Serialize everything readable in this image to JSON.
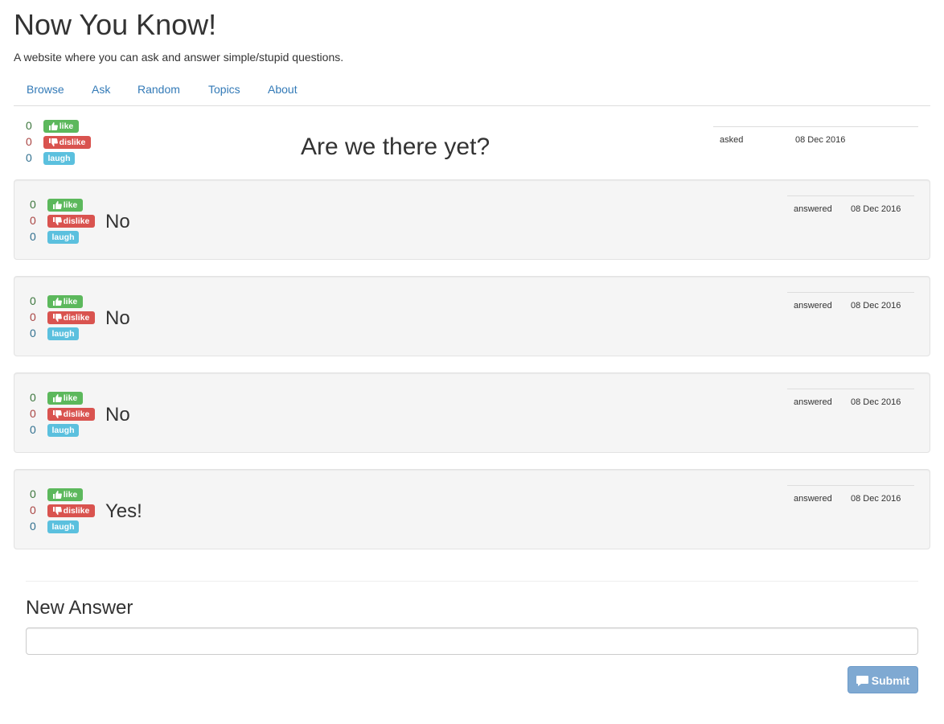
{
  "site": {
    "title": "Now You Know!",
    "subtitle": "A website where you can ask and answer simple/stupid questions."
  },
  "nav": [
    "Browse",
    "Ask",
    "Random",
    "Topics",
    "About"
  ],
  "labels": {
    "like": "like",
    "dislike": "dislike",
    "laugh": "laugh"
  },
  "colors": {
    "like": "#5cb85c",
    "dislike": "#d9534f",
    "laugh": "#5bc0de",
    "link": "#337ab7",
    "submit": "#7fa9d2"
  },
  "question": {
    "title": "Are we there yet?",
    "likes": "0",
    "dislikes": "0",
    "laughs": "0",
    "meta_label": "asked",
    "date": "08 Dec 2016"
  },
  "answers": [
    {
      "text": "No",
      "likes": "0",
      "dislikes": "0",
      "laughs": "0",
      "meta_label": "answered",
      "date": "08 Dec 2016"
    },
    {
      "text": "No",
      "likes": "0",
      "dislikes": "0",
      "laughs": "0",
      "meta_label": "answered",
      "date": "08 Dec 2016"
    },
    {
      "text": "No",
      "likes": "0",
      "dislikes": "0",
      "laughs": "0",
      "meta_label": "answered",
      "date": "08 Dec 2016"
    },
    {
      "text": "Yes!",
      "likes": "0",
      "dislikes": "0",
      "laughs": "0",
      "meta_label": "answered",
      "date": "08 Dec 2016"
    }
  ],
  "form": {
    "heading": "New Answer",
    "input_value": "",
    "input_placeholder": "",
    "submit_label": "Submit",
    "submit_icon": "comment-icon"
  },
  "icons": {
    "like": "thumbs-up-icon",
    "dislike": "thumbs-down-icon"
  }
}
